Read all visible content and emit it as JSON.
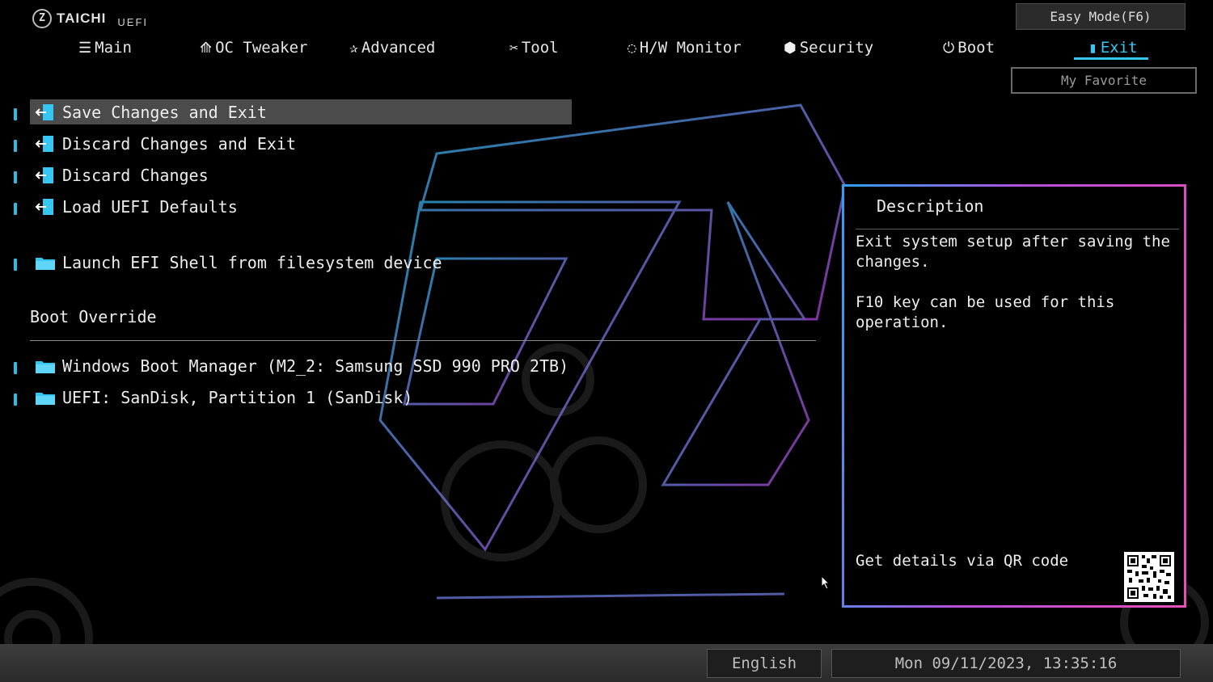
{
  "brand": {
    "logo_letter": "Z",
    "name": "TAICHI",
    "sub": "UEFI"
  },
  "nav": {
    "tabs": [
      {
        "label": "Main",
        "icon": "list-icon",
        "glyph": "☰"
      },
      {
        "label": "OC Tweaker",
        "icon": "rocket-icon",
        "glyph": "⟰"
      },
      {
        "label": "Advanced",
        "icon": "star-icon",
        "glyph": "✰"
      },
      {
        "label": "Tool",
        "icon": "tools-icon",
        "glyph": "✂"
      },
      {
        "label": "H/W Monitor",
        "icon": "monitor-icon",
        "glyph": "◌"
      },
      {
        "label": "Security",
        "icon": "shield-icon",
        "glyph": "⬢"
      },
      {
        "label": "Boot",
        "icon": "power-icon",
        "glyph": "⏻"
      },
      {
        "label": "Exit",
        "icon": "exit-door-icon",
        "glyph": "▮"
      }
    ],
    "active": "Exit"
  },
  "buttons": {
    "easy_mode": "Easy Mode(F6)",
    "my_favorite": "My Favorite"
  },
  "menu": {
    "items": [
      {
        "label": "Save Changes and Exit",
        "icon": "exit-arrow-icon"
      },
      {
        "label": "Discard Changes and Exit",
        "icon": "exit-arrow-icon"
      },
      {
        "label": "Discard Changes",
        "icon": "exit-arrow-icon"
      },
      {
        "label": "Load UEFI Defaults",
        "icon": "exit-arrow-icon"
      },
      {
        "label": "Launch EFI Shell from filesystem device",
        "icon": "folder-icon"
      }
    ],
    "selected": "Save Changes and Exit",
    "boot_override_title": "Boot Override",
    "boot_items": [
      {
        "label": "Windows Boot Manager (M2_2: Samsung SSD 990 PRO 2TB)",
        "icon": "folder-icon"
      },
      {
        "label": "UEFI: SanDisk, Partition 1 (SanDisk)",
        "icon": "folder-icon"
      }
    ]
  },
  "description": {
    "title": "Description",
    "text": "Exit system setup after saving the\nchanges.\n\nF10 key can be used for this\noperation.",
    "qr_label": "Get details via QR code"
  },
  "status": {
    "language": "English",
    "datetime": "Mon 09/11/2023, 13:35:16"
  },
  "colors": {
    "accent": "#35c7f2",
    "selected_row": "#4b4b4b",
    "panel_border_start": "#2f9ff2",
    "panel_border_end": "#e84eb8"
  }
}
